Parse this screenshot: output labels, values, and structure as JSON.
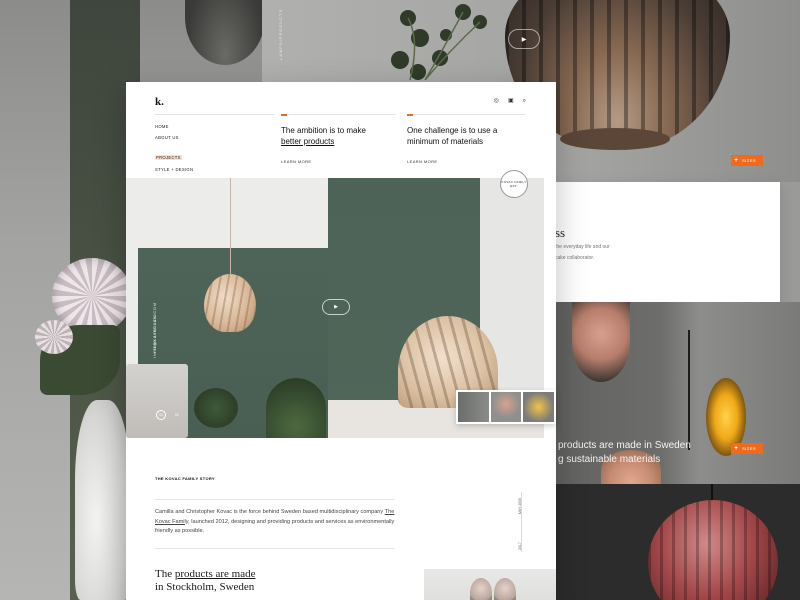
{
  "background": {
    "vertical_caption": "LAMPS/PRODUCTS",
    "top_play_icon": "play-icon",
    "top_tag": {
      "label": "SIZES"
    },
    "panel": {
      "heading": "ss",
      "line1": "the everyday life and our",
      "line2": "cake collaborator."
    },
    "mid_tag": {
      "label": "SIZES"
    },
    "mid_text_line1": "products are made in Sweden",
    "mid_text_line2": "g sustainable materials",
    "colors": {
      "accent": "#f06a1e",
      "sage": "#4e6458"
    }
  },
  "header": {
    "logo": "k.",
    "icons": [
      "instagram-icon",
      "bag-icon",
      "search-icon"
    ]
  },
  "nav": {
    "items": [
      {
        "label": "HOME"
      },
      {
        "label": "ABOUT US"
      },
      {
        "label": "PROJECTS",
        "active": true
      },
      {
        "label": "STYLE + DESIGN"
      }
    ]
  },
  "features": [
    {
      "text_before": "The ambition is to make",
      "text_link": "better products",
      "more": "LEARN MORE"
    },
    {
      "text_before": "One challenge is to use a",
      "text_after": "minimum of materials",
      "more": "LEARN MORE"
    }
  ],
  "hero": {
    "email": "INFO@KAYKOLEN.COM",
    "phone": "+4658 3466 3456",
    "badge": "KOVAC FAMILY EST.",
    "play_icon": "play-icon",
    "pager": [
      "01",
      "02"
    ]
  },
  "story": {
    "label": "THE KOVAC FAMILY STORY",
    "text_1": "Camilla and Christopher Kovac is the force behind Sweden based multidisciplinary company ",
    "text_link": "The Kovac Family",
    "text_2": ", launched 2012, designing and providing products and services as environmentally friendly as possible.",
    "timeline_1": "MAY 2006",
    "timeline_2": "2017"
  },
  "products": {
    "pre": "The ",
    "link": "products are made",
    "line2": "in Stockholm, Sweden"
  }
}
